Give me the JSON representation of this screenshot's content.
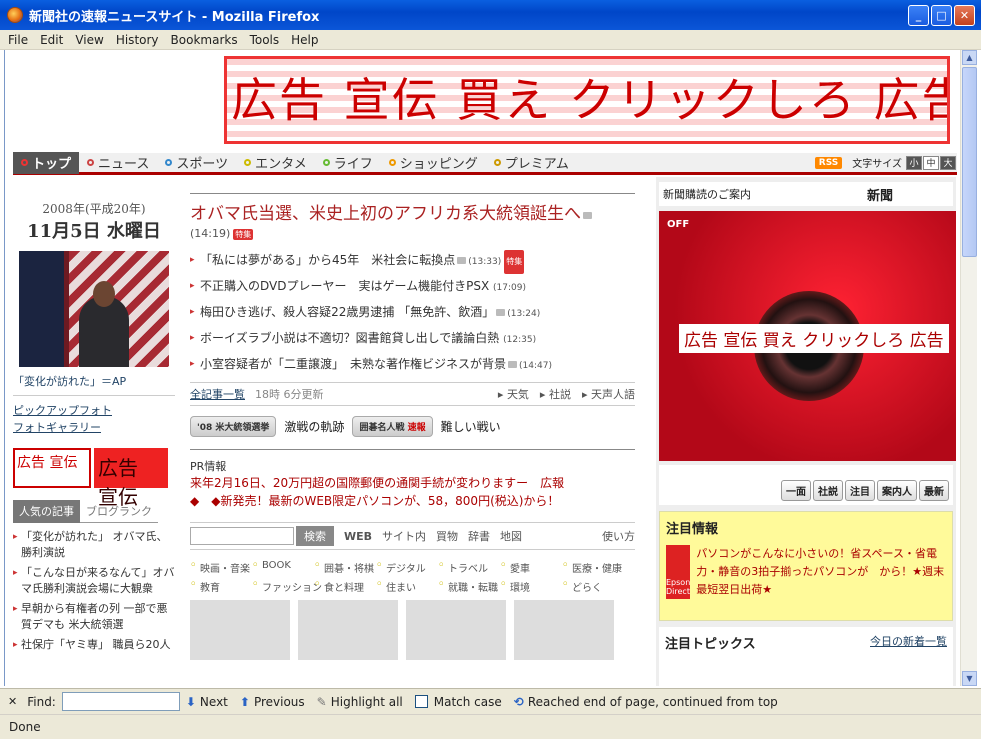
{
  "window": {
    "title": "新聞社の速報ニュースサイト - Mozilla Firefox"
  },
  "menu": [
    "File",
    "Edit",
    "View",
    "History",
    "Bookmarks",
    "Tools",
    "Help"
  ],
  "banner_ad": {
    "text": "広告 宣伝 買え クリックしろ 広告 宣伝 買え クリックしろ"
  },
  "nav": {
    "items": [
      "トップ",
      "ニュース",
      "スポーツ",
      "エンタメ",
      "ライフ",
      "ショッピング",
      "プレミアム"
    ],
    "rss": "RSS",
    "font_size_label": "文字サイズ",
    "font_sizes": [
      "小",
      "中",
      "大"
    ]
  },
  "left": {
    "date_era": "2008年(平成20年)",
    "date_main": "11月5日 水曜日",
    "caption": "「変化が訪れた」＝AP",
    "links": [
      "ピックアップフォト",
      "フォトギャラリー"
    ],
    "ad1": "広告 宣伝",
    "ad2": "広告 宣伝",
    "tabs": [
      "人気の記事",
      "ブログランク"
    ],
    "popular": [
      "「変化が訪れた」 オバマ氏、勝利演説",
      "「こんな日が来るなんて」オバマ氏勝利演説会場に大観衆",
      "早朝から有権者の列 一部で悪質デマも 米大統領選",
      "社保庁「ヤミ専」 職員ら20人"
    ]
  },
  "center": {
    "headline": "オバマ氏当選、米史上初のアフリカ系大統領誕生へ",
    "headline_time": "(14:19)",
    "badge": "特集",
    "news": [
      {
        "text": "「私には夢がある」から45年　米社会に転換点",
        "time": "(13:33)",
        "badge": "特集"
      },
      {
        "text": "不正購入のDVDプレーヤー　実はゲーム機能付きPSX",
        "time": "(17:09)",
        "badge": ""
      },
      {
        "text": "梅田ひき逃げ、殺人容疑22歳男逮捕 「無免許、飲酒」",
        "time": "(13:24)",
        "badge": ""
      },
      {
        "text": "ボーイズラブ小説は不適切？図書館貸し出しで議論白熱",
        "time": "(12:35)",
        "badge": ""
      },
      {
        "text": "小室容疑者が「二重譲渡」　未熟な著作権ビジネスが背景",
        "time": "(14:47)",
        "badge": ""
      }
    ],
    "all_news": "全記事一覧",
    "updated": "18時 6分更新",
    "cats": [
      "天気",
      "社説",
      "天声人語"
    ],
    "special1_btn": "'08 米大統領選挙",
    "special1_text": "激戦の軌跡",
    "special2_btn": "囲碁名人戦",
    "special2_sub": "速報",
    "special2_text": "難しい戦い",
    "pr_label": "PR情報",
    "pr_lines": [
      "来年2月16日、20万円超の国際郵便の通関手続が変わりますー　広報",
      "◆　◆新発売！最新のWEB限定パソコンが、58，800円(税込)から！"
    ],
    "search_btn": "検索",
    "search_tabs": [
      "WEB",
      "サイト内",
      "買物",
      "辞書",
      "地図",
      "使い方"
    ],
    "categories": [
      "映画・音楽",
      "BOOK",
      "囲碁・将棋",
      "デジタル",
      "トラベル",
      "愛車",
      "医療・健康",
      "教育",
      "ファッション",
      "食と料理",
      "住まい",
      "就職・転職",
      "環境",
      "どらく"
    ]
  },
  "right": {
    "subscribe": "新聞購読のご案内",
    "subscribe_logo": "新聞",
    "camera_off": "OFF",
    "camera_ad": "広告 宣伝 買え クリックしろ 広告",
    "shortcuts": [
      "一面",
      "社説",
      "注目",
      "案内人",
      "最新"
    ],
    "attention_title": "注目情報",
    "epson": "Epson Direct",
    "attention_text": "パソコンがこんなに小さいの！省スペース・省電力・静音の3拍子揃ったパソコンが　から！★週末最短翌日出荷★",
    "topics_title": "注目トピックス",
    "topics_link": "今日の新着一覧"
  },
  "findbar": {
    "close": "✕",
    "label": "Find:",
    "next": "Next",
    "previous": "Previous",
    "highlight": "Highlight all",
    "match_case": "Match case",
    "status": "Reached end of page, continued from top"
  },
  "statusbar": {
    "text": "Done"
  }
}
